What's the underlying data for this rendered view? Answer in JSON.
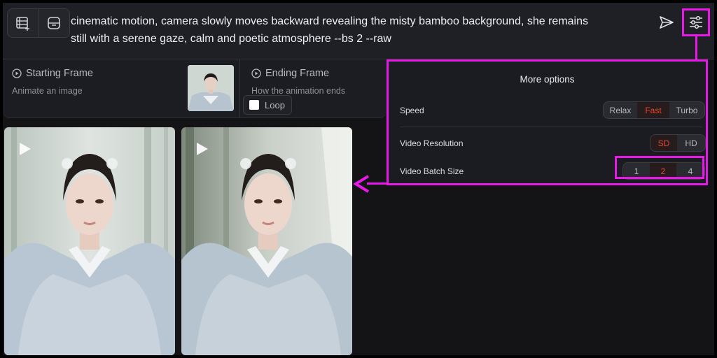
{
  "prompt": {
    "line1": "cinematic motion, camera slowly moves backward revealing the misty bamboo background, she remains",
    "line2": "still with a serene gaze, calm and poetic atmosphere --bs 2 --raw"
  },
  "toolbar": {
    "icons": [
      "video-add-icon",
      "image-frame-icon",
      "send-icon",
      "sliders-icon"
    ]
  },
  "starting_frame": {
    "title": "Starting Frame",
    "subtitle": "Animate an image"
  },
  "ending_frame": {
    "title": "Ending Frame",
    "subtitle": "How the animation ends",
    "loop_label": "Loop"
  },
  "more_options": {
    "title": "More options",
    "speed": {
      "label": "Speed",
      "options": [
        "Relax",
        "Fast",
        "Turbo"
      ],
      "selected": "Fast"
    },
    "resolution": {
      "label": "Video Resolution",
      "options": [
        "SD",
        "HD"
      ],
      "selected": "SD"
    },
    "batch": {
      "label": "Video Batch Size",
      "options": [
        "1",
        "2",
        "4"
      ],
      "selected": "2"
    }
  },
  "colors": {
    "accent": "#e8462c",
    "highlight": "#e619e6",
    "background": "#141417"
  }
}
